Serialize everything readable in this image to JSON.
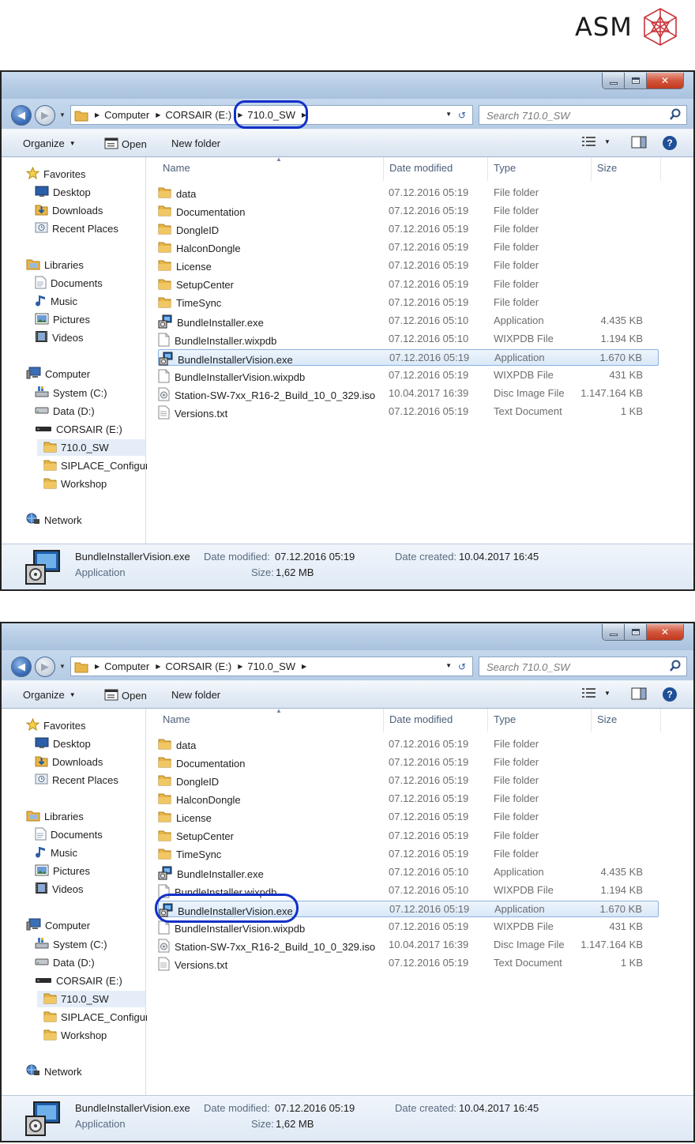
{
  "brand": {
    "name": "ASM",
    "colors": {
      "accent": "#1230c8",
      "select": "#d8e8f8"
    }
  },
  "window": {
    "breadcrumb": [
      "Computer",
      "CORSAIR (E:)",
      "710.0_SW"
    ],
    "search_placeholder": "Search 710.0_SW",
    "toolbar": {
      "organize": "Organize",
      "open": "Open",
      "new_folder": "New folder"
    },
    "columns": {
      "name": "Name",
      "date": "Date modified",
      "type": "Type",
      "size": "Size"
    },
    "nav": {
      "favorites": "Favorites",
      "desktop": "Desktop",
      "downloads": "Downloads",
      "recent": "Recent Places",
      "libraries": "Libraries",
      "documents": "Documents",
      "music": "Music",
      "pictures": "Pictures",
      "videos": "Videos",
      "computer": "Computer",
      "system": "System (C:)",
      "data": "Data (D:)",
      "corsair": "CORSAIR (E:)",
      "f710": "710.0_SW",
      "siplace": "SIPLACE_Configur",
      "workshop": "Workshop",
      "network": "Network"
    },
    "files": [
      {
        "name": "data",
        "date": "07.12.2016 05:19",
        "type": "File folder",
        "size": "",
        "icon": "folder-icon"
      },
      {
        "name": "Documentation",
        "date": "07.12.2016 05:19",
        "type": "File folder",
        "size": "",
        "icon": "folder-icon"
      },
      {
        "name": "DongleID",
        "date": "07.12.2016 05:19",
        "type": "File folder",
        "size": "",
        "icon": "folder-icon"
      },
      {
        "name": "HalconDongle",
        "date": "07.12.2016 05:19",
        "type": "File folder",
        "size": "",
        "icon": "folder-icon"
      },
      {
        "name": "License",
        "date": "07.12.2016 05:19",
        "type": "File folder",
        "size": "",
        "icon": "folder-icon"
      },
      {
        "name": "SetupCenter",
        "date": "07.12.2016 05:19",
        "type": "File folder",
        "size": "",
        "icon": "folder-icon"
      },
      {
        "name": "TimeSync",
        "date": "07.12.2016 05:19",
        "type": "File folder",
        "size": "",
        "icon": "folder-icon"
      },
      {
        "name": "BundleInstaller.exe",
        "date": "07.12.2016 05:10",
        "type": "Application",
        "size": "4.435 KB",
        "icon": "installer-icon"
      },
      {
        "name": "BundleInstaller.wixpdb",
        "date": "07.12.2016 05:10",
        "type": "WIXPDB File",
        "size": "1.194 KB",
        "icon": "file-icon"
      },
      {
        "name": "BundleInstallerVision.exe",
        "date": "07.12.2016 05:19",
        "type": "Application",
        "size": "1.670 KB",
        "icon": "installer-icon"
      },
      {
        "name": "BundleInstallerVision.wixpdb",
        "date": "07.12.2016 05:19",
        "type": "WIXPDB File",
        "size": "431 KB",
        "icon": "file-icon"
      },
      {
        "name": "Station-SW-7xx_R16-2_Build_10_0_329.iso",
        "date": "10.04.2017 16:39",
        "type": "Disc Image File",
        "size": "1.147.164 KB",
        "icon": "disc-image-icon"
      },
      {
        "name": "Versions.txt",
        "date": "07.12.2016 05:19",
        "type": "Text Document",
        "size": "1 KB",
        "icon": "text-file-icon"
      }
    ],
    "details": {
      "file_name": "BundleInstallerVision.exe",
      "modified_label": "Date modified:",
      "modified_value": "07.12.2016 05:19",
      "created_label": "Date created:",
      "created_value": "10.04.2017 16:45",
      "type": "Application",
      "size_label": "Size:",
      "size_value": "1,62 MB"
    }
  }
}
